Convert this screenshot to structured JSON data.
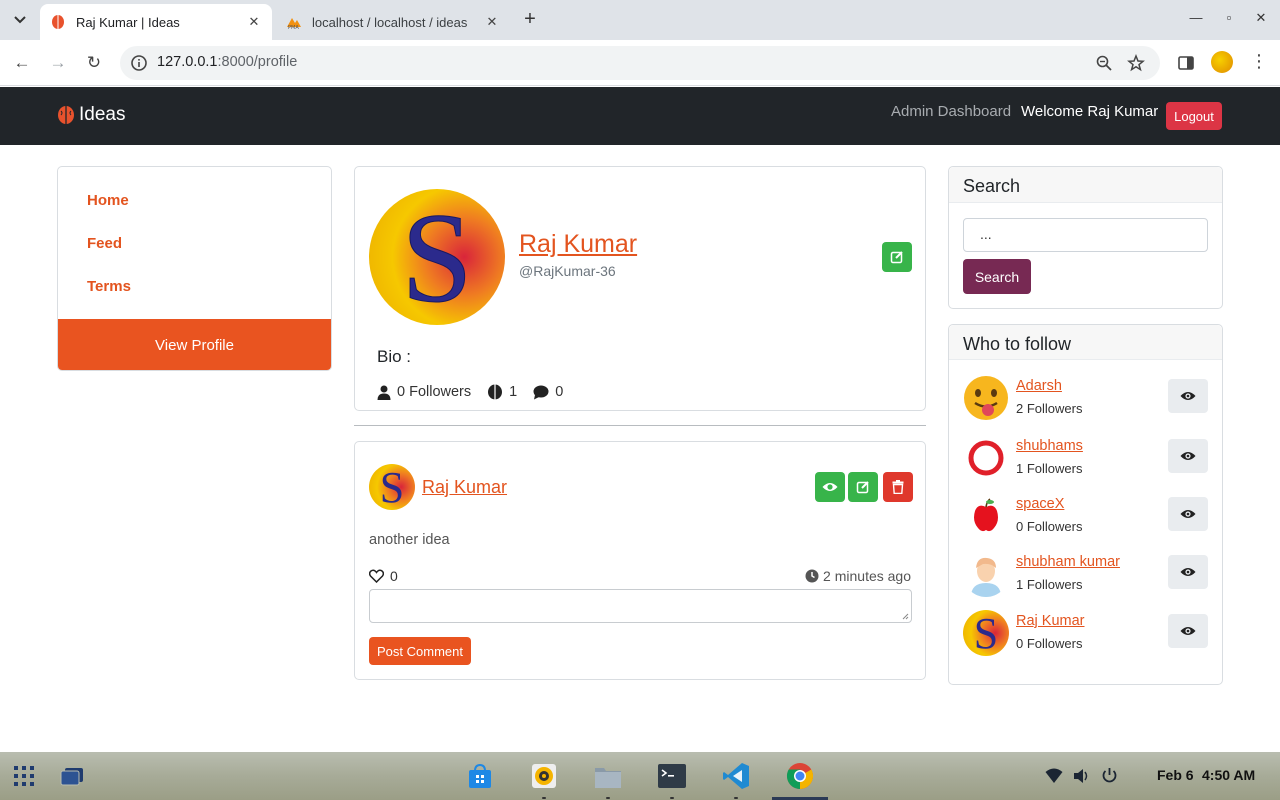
{
  "browser": {
    "tabs": [
      {
        "title": "Raj Kumar | Ideas",
        "active": true
      },
      {
        "title": "localhost / localhost / ideas",
        "active": false
      }
    ],
    "url_host": "127.0.0.1",
    "url_path": ":8000/profile"
  },
  "navbar": {
    "brand": "Ideas",
    "admin_link": "Admin Dashboard",
    "welcome": "Welcome Raj Kumar",
    "logout": "Logout"
  },
  "sidebar": {
    "items": [
      {
        "label": "Home"
      },
      {
        "label": "Feed"
      },
      {
        "label": "Terms"
      }
    ],
    "view_profile": "View Profile"
  },
  "profile": {
    "name": "Raj Kumar",
    "handle": "@RajKumar-36",
    "bio_label": "Bio :",
    "followers_label": "0 Followers",
    "ideas_count": "1",
    "comments_count": "0"
  },
  "idea": {
    "author": "Raj Kumar",
    "content": "another idea",
    "likes": "0",
    "time": "2 minutes ago",
    "comment_placeholder": "",
    "post_comment": "Post Comment"
  },
  "search": {
    "title": "Search",
    "value": "...",
    "button": "Search"
  },
  "who_to_follow": {
    "title": "Who to follow",
    "users": [
      {
        "name": "Adarsh",
        "followers": "2 Followers",
        "avatar": "tongue-emoji"
      },
      {
        "name": "shubhams",
        "followers": "1 Followers",
        "avatar": "red-ring"
      },
      {
        "name": "spaceX",
        "followers": "0 Followers",
        "avatar": "apple"
      },
      {
        "name": "shubham kumar",
        "followers": "1 Followers",
        "avatar": "person"
      },
      {
        "name": "Raj Kumar",
        "followers": "0 Followers",
        "avatar": "letter-s"
      }
    ]
  },
  "taskbar": {
    "date": "Feb 6",
    "time": "4:50 AM"
  },
  "colors": {
    "accent": "#e95420",
    "link": "#e3541f",
    "navbar": "#212529",
    "success": "#38b44a",
    "danger": "#df382c",
    "search_button": "#772953"
  }
}
